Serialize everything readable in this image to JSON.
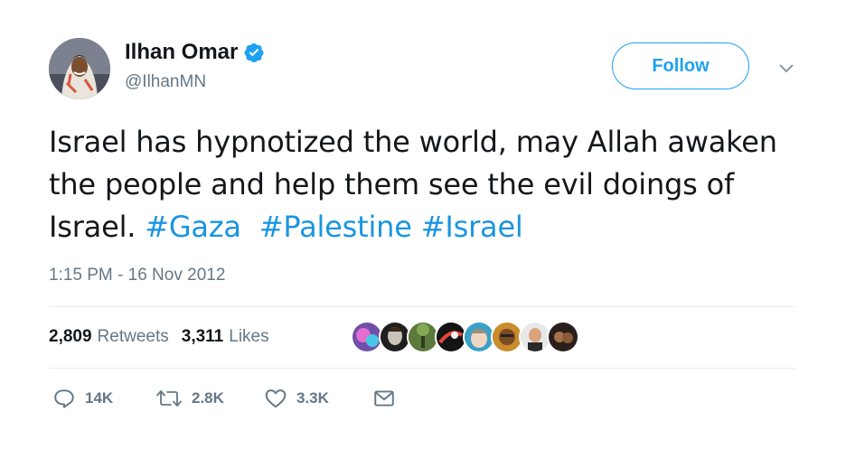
{
  "user": {
    "display_name": "Ilhan Omar",
    "handle": "@IlhanMN",
    "verified_icon": "verified-badge-icon"
  },
  "follow_button": {
    "label": "Follow"
  },
  "tweet": {
    "text_plain": "Israel has hypnotized the world, may Allah awaken the people and help them see the evil doings of Israel.",
    "hashtags": [
      "#Gaza",
      "#Palestine",
      "#Israel"
    ],
    "timestamp": "1:15 PM - 16 Nov 2012"
  },
  "stats": {
    "retweets_count": "2,809",
    "retweets_label": "Retweets",
    "likes_count": "3,311",
    "likes_label": "Likes"
  },
  "actions": {
    "reply_count": "14K",
    "retweet_count": "2.8K",
    "like_count": "3.3K"
  },
  "colors": {
    "accent": "#1da1f2",
    "hashtag": "#1b95e0",
    "secondary_text": "#657786",
    "divider": "#e6ecf0"
  }
}
